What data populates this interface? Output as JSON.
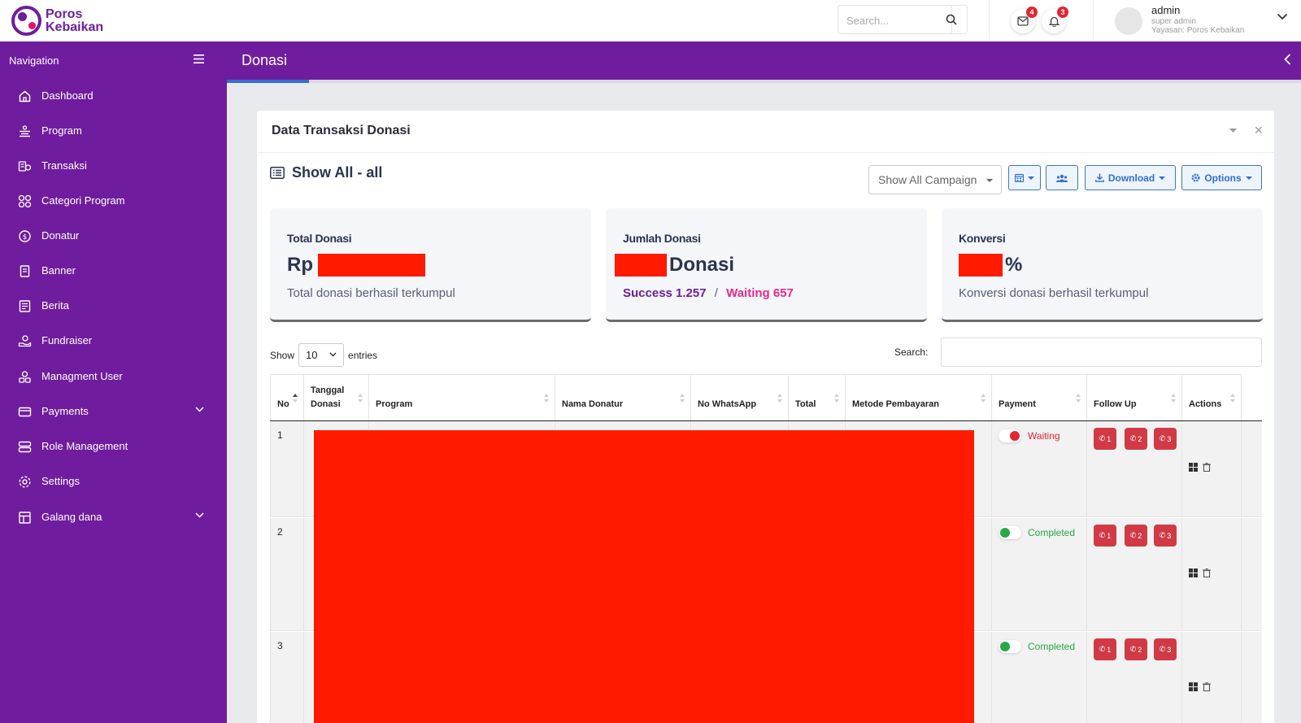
{
  "brand": {
    "name_line1": "Poros",
    "name_line2": "Kebaikan",
    "color": "#6f1d9e"
  },
  "topbar": {
    "search_placeholder": "Search...",
    "mail_badge": "4",
    "bell_badge": "3",
    "user_name": "admin",
    "user_role": "super admin",
    "user_org": "Yayasan: Poros Kebaikan"
  },
  "sidebar": {
    "title": "Navigation",
    "items": [
      {
        "label": "Dashboard",
        "icon": "home-icon"
      },
      {
        "label": "Program",
        "icon": "program-icon"
      },
      {
        "label": "Transaksi",
        "icon": "transaction-icon"
      },
      {
        "label": "Categori Program",
        "icon": "category-icon"
      },
      {
        "label": "Donatur",
        "icon": "coin-icon"
      },
      {
        "label": "Banner",
        "icon": "banner-icon"
      },
      {
        "label": "Berita",
        "icon": "news-icon"
      },
      {
        "label": "Fundraiser",
        "icon": "fundraiser-icon"
      },
      {
        "label": "Managment User",
        "icon": "users-icon"
      },
      {
        "label": "Payments",
        "icon": "card-icon",
        "has_submenu": true
      },
      {
        "label": "Role Management",
        "icon": "server-icon"
      },
      {
        "label": "Settings",
        "icon": "gear-icon"
      },
      {
        "label": "Galang dana",
        "icon": "layout-icon",
        "has_submenu": true
      }
    ]
  },
  "page": {
    "title": "Donasi"
  },
  "card": {
    "title": "Data Transaksi Donasi",
    "filter_title": "Show All - all",
    "campaign_select": "Show All Campaign",
    "download_label": "Download",
    "options_label": "Options"
  },
  "stats": {
    "total": {
      "label": "Total Donasi",
      "prefix": "Rp",
      "sub": "Total donasi berhasil terkumpul"
    },
    "jumlah": {
      "label": "Jumlah Donasi",
      "suffix": "Donasi",
      "success": "Success 1.257",
      "separator": "/",
      "waiting": "Waiting 657"
    },
    "konversi": {
      "label": "Konversi",
      "suffix": "%",
      "sub": "Konversi donasi berhasil terkumpul"
    }
  },
  "table_controls": {
    "show": "Show",
    "length": "10",
    "entries": "entries",
    "search": "Search:"
  },
  "table": {
    "columns": [
      "No",
      "Tanggal Donasi",
      "Program",
      "Nama Donatur",
      "No WhatsApp",
      "Total",
      "Metode Pembayaran",
      "Payment",
      "Follow Up",
      "Actions"
    ],
    "rows": [
      {
        "no": "1",
        "payment": "Waiting",
        "payment_color": "#e3262f",
        "follow_up": [
          "1",
          "2",
          "3"
        ]
      },
      {
        "no": "2",
        "payment": "Completed",
        "payment_color": "#28a745",
        "follow_up": [
          "1",
          "2",
          "3"
        ]
      },
      {
        "no": "3",
        "payment": "Completed",
        "payment_color": "#28a745",
        "follow_up": [
          "1",
          "2",
          "3"
        ]
      }
    ]
  }
}
